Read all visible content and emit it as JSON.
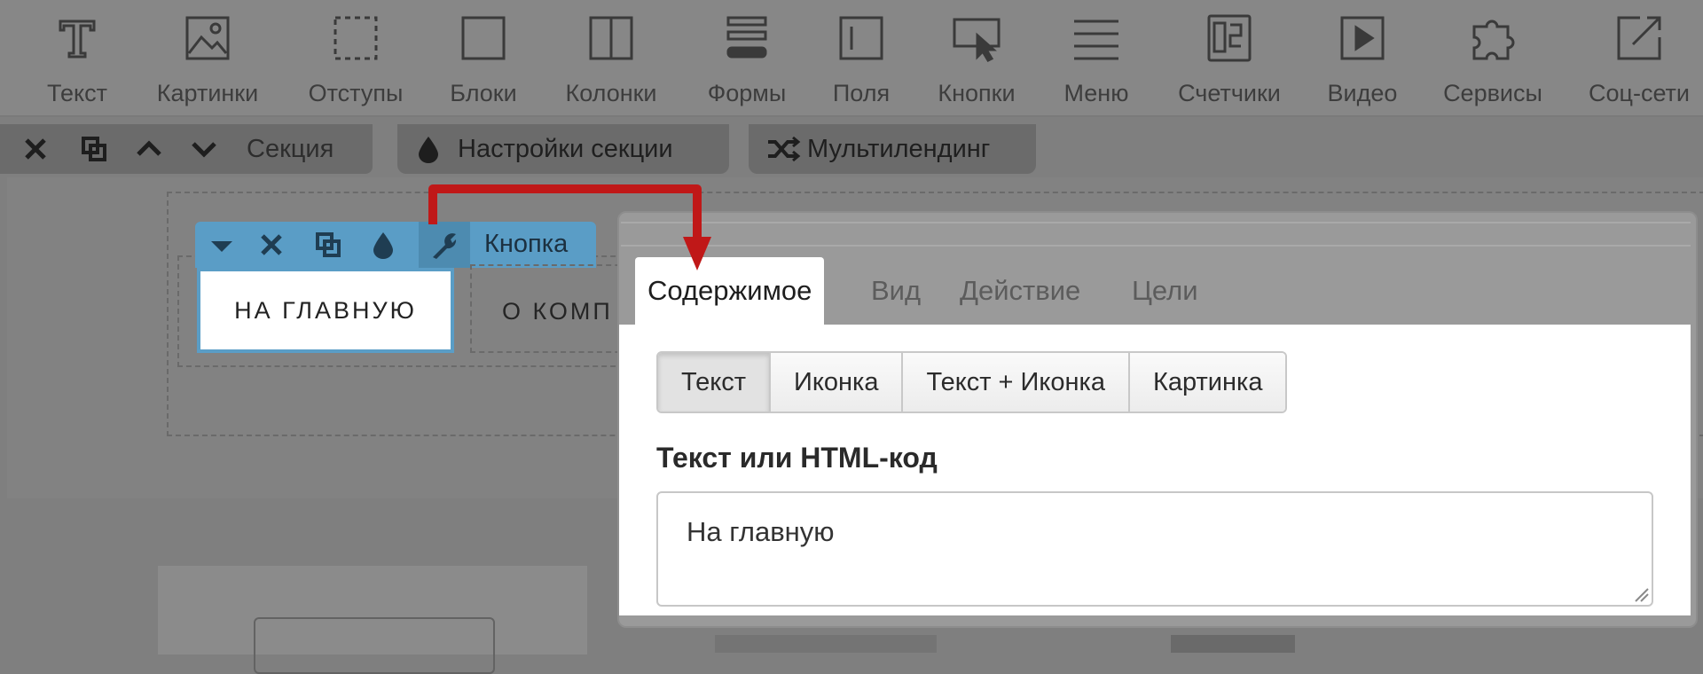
{
  "toolbar": {
    "items": [
      {
        "label": "Текст",
        "icon": "text-icon"
      },
      {
        "label": "Картинки",
        "icon": "image-icon"
      },
      {
        "label": "Отступы",
        "icon": "padding-icon"
      },
      {
        "label": "Блоки",
        "icon": "block-icon"
      },
      {
        "label": "Колонки",
        "icon": "columns-icon"
      },
      {
        "label": "Формы",
        "icon": "form-icon"
      },
      {
        "label": "Поля",
        "icon": "field-icon"
      },
      {
        "label": "Кнопки",
        "icon": "button-icon"
      },
      {
        "label": "Меню",
        "icon": "menu-icon"
      },
      {
        "label": "Счетчики",
        "icon": "counter-icon"
      },
      {
        "label": "Видео",
        "icon": "video-icon"
      },
      {
        "label": "Сервисы",
        "icon": "puzzle-icon"
      },
      {
        "label": "Соц-сети",
        "icon": "share-icon"
      }
    ]
  },
  "section_bar": {
    "label": "Секция",
    "settings_label": "Настройки секции",
    "multilanding_label": "Мультилендинг"
  },
  "element_toolbar": {
    "label": "Кнопка"
  },
  "canvas": {
    "main_button_text": "НА ГЛАВНУЮ",
    "second_button_text": "О КОМП"
  },
  "panel": {
    "tabs": [
      "Содержимое",
      "Вид",
      "Действие",
      "Цели"
    ],
    "active_tab": "Содержимое",
    "segments": [
      "Текст",
      "Иконка",
      "Текст + Иконка",
      "Картинка"
    ],
    "active_segment": "Текст",
    "field_label": "Текст или HTML-код",
    "field_value": "На главную"
  },
  "colors": {
    "element_toolbar": "#5a9dc6",
    "arrow": "#c01818",
    "overlay": "#7f7f7f"
  }
}
